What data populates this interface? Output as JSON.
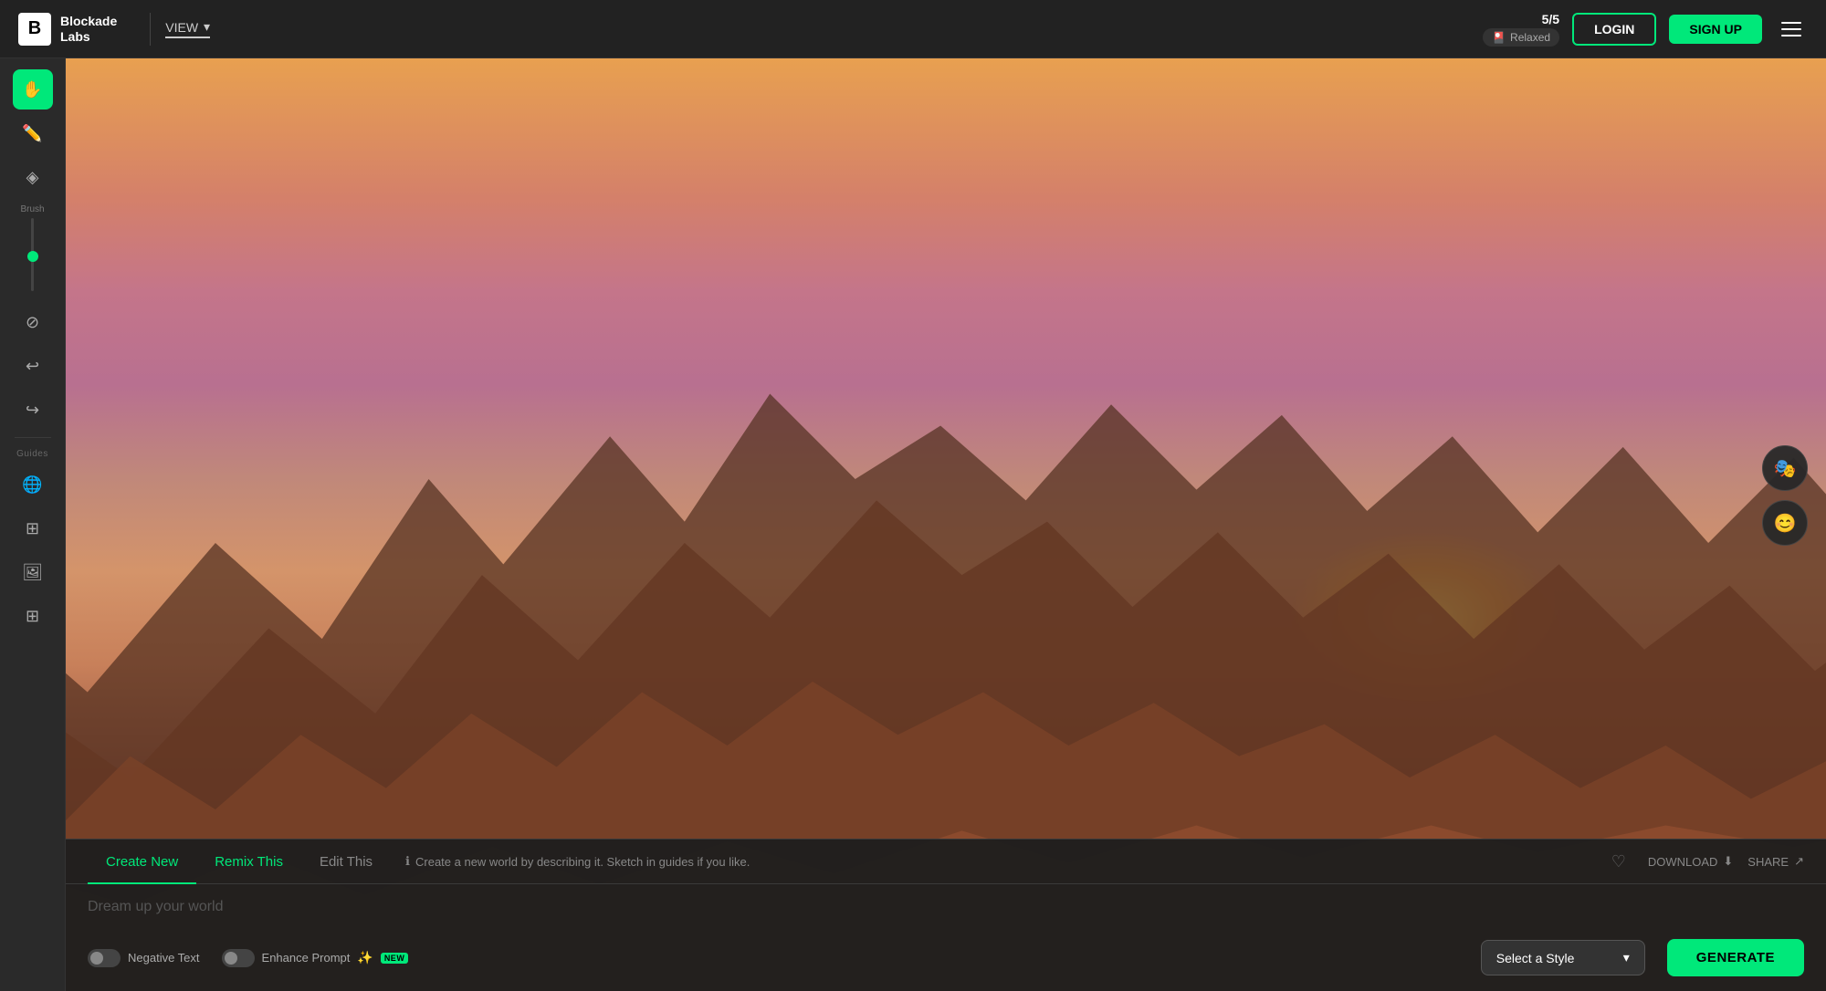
{
  "header": {
    "logo_letter": "B",
    "logo_name": "Blockade\nLabs",
    "view_label": "VIEW",
    "credits": "5/5",
    "mode": "Relaxed",
    "login_label": "LOGIN",
    "signup_label": "SIGN UP"
  },
  "sidebar": {
    "tools": [
      {
        "name": "hand-tool",
        "label": "Hand",
        "icon": "✋",
        "active": true
      },
      {
        "name": "pencil-tool",
        "label": "Pencil",
        "icon": "✏️",
        "active": false
      },
      {
        "name": "brush-tool",
        "label": "Brush",
        "icon": "⬡",
        "active": false
      }
    ],
    "brush_label": "Brush",
    "tools2": [
      {
        "name": "erase-tool",
        "label": "Erase",
        "icon": "⊘",
        "active": false
      },
      {
        "name": "undo-tool",
        "label": "Undo",
        "icon": "↩",
        "active": false
      },
      {
        "name": "redo-tool",
        "label": "Redo",
        "icon": "↪",
        "active": false
      }
    ],
    "guides_label": "Guides",
    "guides": [
      {
        "name": "globe-guide",
        "label": "Globe",
        "icon": "🌐",
        "active": false
      },
      {
        "name": "layer-guide",
        "label": "Layer",
        "icon": "⊞",
        "active": false
      },
      {
        "name": "image-guide",
        "label": "Image",
        "icon": "🖼",
        "active": false
      },
      {
        "name": "grid-guide",
        "label": "Grid",
        "icon": "⊞",
        "active": false
      }
    ]
  },
  "panel": {
    "tabs": [
      {
        "id": "create-new",
        "label": "Create New",
        "active": true
      },
      {
        "id": "remix-this",
        "label": "Remix This",
        "active": false
      },
      {
        "id": "edit-this",
        "label": "Edit This",
        "active": false
      }
    ],
    "hint": "Create a new world by describing it. Sketch in guides if you like.",
    "download_label": "DOWNLOAD",
    "share_label": "SHARE",
    "prompt_placeholder": "Dream up your world",
    "negative_text_label": "Negative Text",
    "enhance_prompt_label": "Enhance Prompt",
    "new_badge": "NEW",
    "style_placeholder": "Select a Style",
    "generate_label": "GENERATE"
  },
  "right_float": [
    {
      "name": "avatar-icon",
      "icon": "🎭"
    },
    {
      "name": "face-icon",
      "icon": "😊"
    }
  ]
}
